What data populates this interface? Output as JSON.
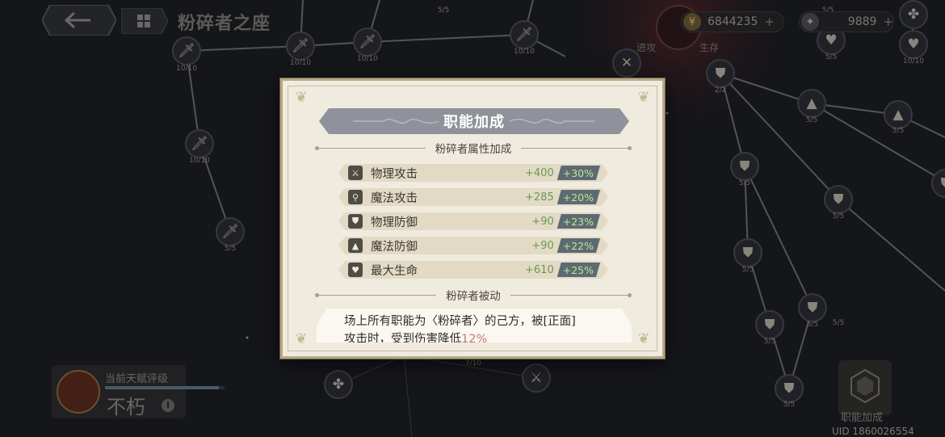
{
  "page": {
    "title": "粉碎者之座"
  },
  "currencies": [
    {
      "icon": "gold-coin-icon",
      "value": "6844235",
      "plus": "+"
    },
    {
      "icon": "swirl-gem-icon",
      "value": "9889",
      "plus": "+"
    }
  ],
  "emblem_labels": {
    "left": "进攻",
    "right": "生存"
  },
  "talent_nodes": [
    {
      "count": "10/10"
    },
    {
      "count": "10/10"
    },
    {
      "count": "10/10"
    },
    {
      "count": "10/10"
    },
    {
      "count": "10/10"
    },
    {
      "count": "5/5"
    },
    {
      "count": "5/5"
    },
    {
      "count": "5/5"
    },
    {
      "count": "5/5"
    },
    {
      "count": "2/2"
    },
    {
      "count": "5/5"
    },
    {
      "count": "5/5"
    },
    {
      "count": "5/5"
    },
    {
      "count": "5/5"
    },
    {
      "count": "5/5"
    },
    {
      "count": "5/5"
    },
    {
      "count": "5/5"
    },
    {
      "count": "5/5"
    },
    {
      "count": "10/10"
    },
    {
      "count": "5/5"
    },
    {
      "count": "7/10"
    }
  ],
  "rating": {
    "title": "当前天赋评级",
    "value": "不朽",
    "info": "i",
    "progress": 0.95
  },
  "class_bonus_button": {
    "label": "职能加成"
  },
  "uid": "UID 1860026554",
  "modal": {
    "title": "职能加成",
    "attr_section": "粉碎者属性加成",
    "stats": [
      {
        "icon": "sword-icon",
        "name": "物理攻击",
        "value": "+400",
        "percent": "+30%"
      },
      {
        "icon": "magic-wand-icon",
        "name": "魔法攻击",
        "value": "+285",
        "percent": "+20%"
      },
      {
        "icon": "shield-icon",
        "name": "物理防御",
        "value": "+90",
        "percent": "+23%"
      },
      {
        "icon": "wizard-hat-icon",
        "name": "魔法防御",
        "value": "+90",
        "percent": "+22%"
      },
      {
        "icon": "heart-icon",
        "name": "最大生命",
        "value": "+610",
        "percent": "+25%"
      }
    ],
    "passive_section": "粉碎者被动",
    "passive_text_a": "场上所有职能为〈粉碎者〉的己方，被[正面]",
    "passive_text_b": "攻击时，受到伤害降低",
    "passive_text_hl": "12%"
  },
  "colors": {
    "modal_bg": "#f0ebdf",
    "banner": "#8f929a",
    "percent_text": "#b9ea8e",
    "value_text": "#6a9a4e",
    "highlight": "#c07a73"
  }
}
